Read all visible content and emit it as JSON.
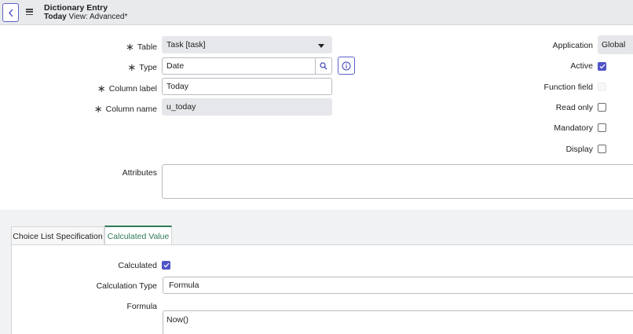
{
  "header": {
    "title": "Dictionary Entry",
    "record": "Today",
    "view": "View: Advanced*"
  },
  "form": {
    "table": {
      "label": "Table",
      "value": "Task [task]"
    },
    "type": {
      "label": "Type",
      "value": "Date"
    },
    "column_label": {
      "label": "Column label",
      "value": "Today"
    },
    "column_name": {
      "label": "Column name",
      "value": "u_today"
    },
    "attributes": {
      "label": "Attributes",
      "value": ""
    },
    "application": {
      "label": "Application",
      "value": "Global"
    },
    "active": {
      "label": "Active",
      "checked": true
    },
    "function_field": {
      "label": "Function field",
      "checked": false
    },
    "read_only": {
      "label": "Read only",
      "checked": false
    },
    "mandatory": {
      "label": "Mandatory",
      "checked": false
    },
    "display": {
      "label": "Display",
      "checked": false
    }
  },
  "tabs": [
    {
      "label": "Choice List Specification",
      "active": false
    },
    {
      "label": "Calculated Value",
      "active": true
    }
  ],
  "calculated_value": {
    "calculated": {
      "label": "Calculated",
      "checked": true
    },
    "calculation_type": {
      "label": "Calculation Type",
      "value": "Formula"
    },
    "formula": {
      "label": "Formula",
      "value": "Now()"
    }
  },
  "colors": {
    "accent": "#4f53c7",
    "tab_active": "#2f7a58"
  }
}
